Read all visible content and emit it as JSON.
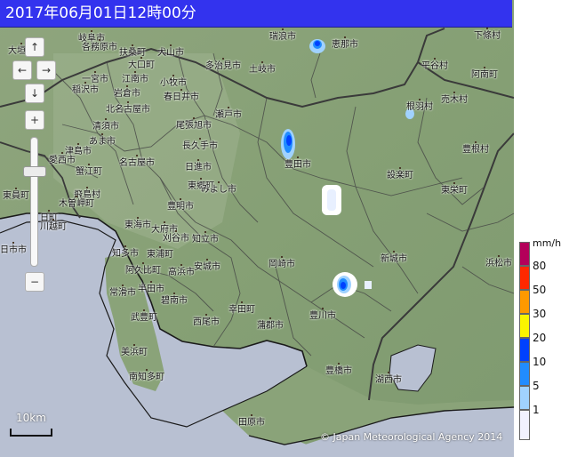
{
  "title": "2017年06月01日12時00分",
  "controls": {
    "pan_up": "↑",
    "pan_left": "←",
    "pan_right": "→",
    "pan_down": "↓",
    "zoom_in": "+",
    "zoom_out": "−"
  },
  "scale_label": "10km",
  "copyright": "© Japan Meteorological Agency 2014",
  "legend": {
    "unit": "mm/h",
    "levels": [
      {
        "label": "80",
        "color": "#b4005a"
      },
      {
        "label": "50",
        "color": "#ff2800"
      },
      {
        "label": "30",
        "color": "#ff9900"
      },
      {
        "label": "20",
        "color": "#faf500"
      },
      {
        "label": "10",
        "color": "#0041ff"
      },
      {
        "label": "5",
        "color": "#218cff"
      },
      {
        "label": "1",
        "color": "#a0d2ff"
      },
      {
        "label": "",
        "color": "#f2f2ff"
      }
    ]
  },
  "cities": [
    {
      "id": "c01",
      "name": "瑞浪市"
    },
    {
      "id": "c02",
      "name": "恵那市"
    },
    {
      "id": "c03",
      "name": "下條村"
    },
    {
      "id": "c04",
      "name": "大垣市"
    },
    {
      "id": "c05",
      "name": "岐阜市"
    },
    {
      "id": "c06",
      "name": "各務原市"
    },
    {
      "id": "c07",
      "name": "扶桑町"
    },
    {
      "id": "c08",
      "name": "犬山市"
    },
    {
      "id": "c09",
      "name": "大口町"
    },
    {
      "id": "c10",
      "name": "多治見市"
    },
    {
      "id": "c11",
      "name": "土岐市"
    },
    {
      "id": "c12",
      "name": "平谷村"
    },
    {
      "id": "c13",
      "name": "阿南町"
    },
    {
      "id": "c14",
      "name": "一宮市"
    },
    {
      "id": "c15",
      "name": "江南市"
    },
    {
      "id": "c16",
      "name": "小牧市"
    },
    {
      "id": "c17",
      "name": "岩倉市"
    },
    {
      "id": "c18",
      "name": "北名古屋市"
    },
    {
      "id": "c19",
      "name": "春日井市"
    },
    {
      "id": "c20",
      "name": "稲沢市"
    },
    {
      "id": "c21",
      "name": "根羽村"
    },
    {
      "id": "c22",
      "name": "売木村"
    },
    {
      "id": "c23",
      "name": "清須市"
    },
    {
      "id": "c24",
      "name": "尾張旭市"
    },
    {
      "id": "c25",
      "name": "瀬戸市"
    },
    {
      "id": "c26",
      "name": "あま市"
    },
    {
      "id": "c27",
      "name": "津島市"
    },
    {
      "id": "c28",
      "name": "長久手市"
    },
    {
      "id": "c29",
      "name": "愛西市"
    },
    {
      "id": "c30",
      "name": "蟹江町"
    },
    {
      "id": "c31",
      "name": "名古屋市"
    },
    {
      "id": "c32",
      "name": "日進市"
    },
    {
      "id": "c33",
      "name": "豊田市"
    },
    {
      "id": "c34",
      "name": "豊根村"
    },
    {
      "id": "c35",
      "name": "設楽町"
    },
    {
      "id": "c36",
      "name": "東栄町"
    },
    {
      "id": "c37",
      "name": "東員町"
    },
    {
      "id": "c38",
      "name": "東郷町"
    },
    {
      "id": "c39",
      "name": "みよし市"
    },
    {
      "id": "c40",
      "name": "飛島村"
    },
    {
      "id": "c41",
      "name": "木曽岬町"
    },
    {
      "id": "c42",
      "name": "豊明市"
    },
    {
      "id": "c43",
      "name": "日町"
    },
    {
      "id": "c44",
      "name": "川越町"
    },
    {
      "id": "c45",
      "name": "東海市"
    },
    {
      "id": "c46",
      "name": "大府市"
    },
    {
      "id": "c47",
      "name": "刈谷市"
    },
    {
      "id": "c48",
      "name": "知立市"
    },
    {
      "id": "c49",
      "name": "日市市"
    },
    {
      "id": "c50",
      "name": "知多市"
    },
    {
      "id": "c51",
      "name": "東浦町"
    },
    {
      "id": "c52",
      "name": "高浜市"
    },
    {
      "id": "c53",
      "name": "安城市"
    },
    {
      "id": "c54",
      "name": "岡崎市"
    },
    {
      "id": "c55",
      "name": "新城市"
    },
    {
      "id": "c56",
      "name": "浜松市"
    },
    {
      "id": "c57",
      "name": "阿久比町"
    },
    {
      "id": "c58",
      "name": "半田市"
    },
    {
      "id": "c59",
      "name": "碧南市"
    },
    {
      "id": "c60",
      "name": "常滑市"
    },
    {
      "id": "c61",
      "name": "武豊町"
    },
    {
      "id": "c62",
      "name": "西尾市"
    },
    {
      "id": "c63",
      "name": "幸田町"
    },
    {
      "id": "c64",
      "name": "豊川市"
    },
    {
      "id": "c65",
      "name": "蒲郡市"
    },
    {
      "id": "c66",
      "name": "美浜町"
    },
    {
      "id": "c67",
      "name": "南知多町"
    },
    {
      "id": "c68",
      "name": "豊橋市"
    },
    {
      "id": "c69",
      "name": "湖西市"
    },
    {
      "id": "c70",
      "name": "田原市"
    }
  ]
}
